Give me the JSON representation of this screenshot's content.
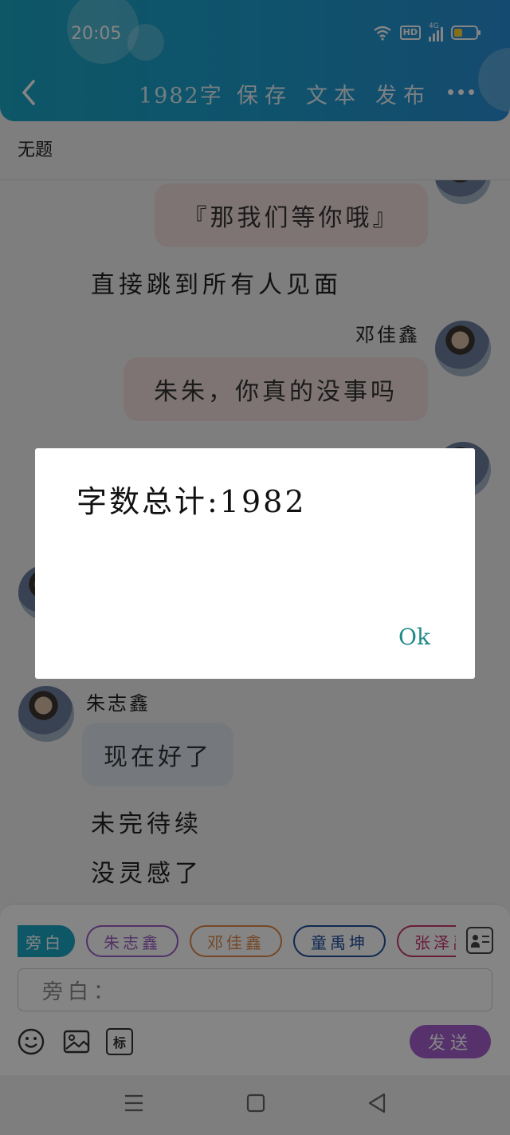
{
  "status_bar": {
    "time": "20:05",
    "hd": "HD",
    "network": "4G"
  },
  "header": {
    "title": "1982字",
    "actions": [
      "保存",
      "文本",
      "发布"
    ]
  },
  "document": {
    "title": "无题"
  },
  "chat": {
    "msg1": "『那我们等你哦』",
    "narration1": "直接跳到所有人见面",
    "speaker2": "邓佳鑫",
    "msg2": "朱朱，你真的没事吗",
    "speaker3": "朱志鑫",
    "msg3": "现在好了",
    "narration2": "未完待续",
    "narration3": "没灵感了"
  },
  "input_panel": {
    "chips": [
      {
        "label": "旁白",
        "color": "#1aa7c4"
      },
      {
        "label": "朱志鑫",
        "color": "#9b5fc6"
      },
      {
        "label": "邓佳鑫",
        "color": "#e0894a"
      },
      {
        "label": "童禹坤",
        "color": "#1d4f9c"
      },
      {
        "label": "张泽禹",
        "color": "#c7376f"
      }
    ],
    "input_value": "旁白：",
    "send_label": "发送",
    "stamp_label": "标"
  },
  "dialog": {
    "message": "字数总计:1982",
    "ok_label": "Ok"
  }
}
